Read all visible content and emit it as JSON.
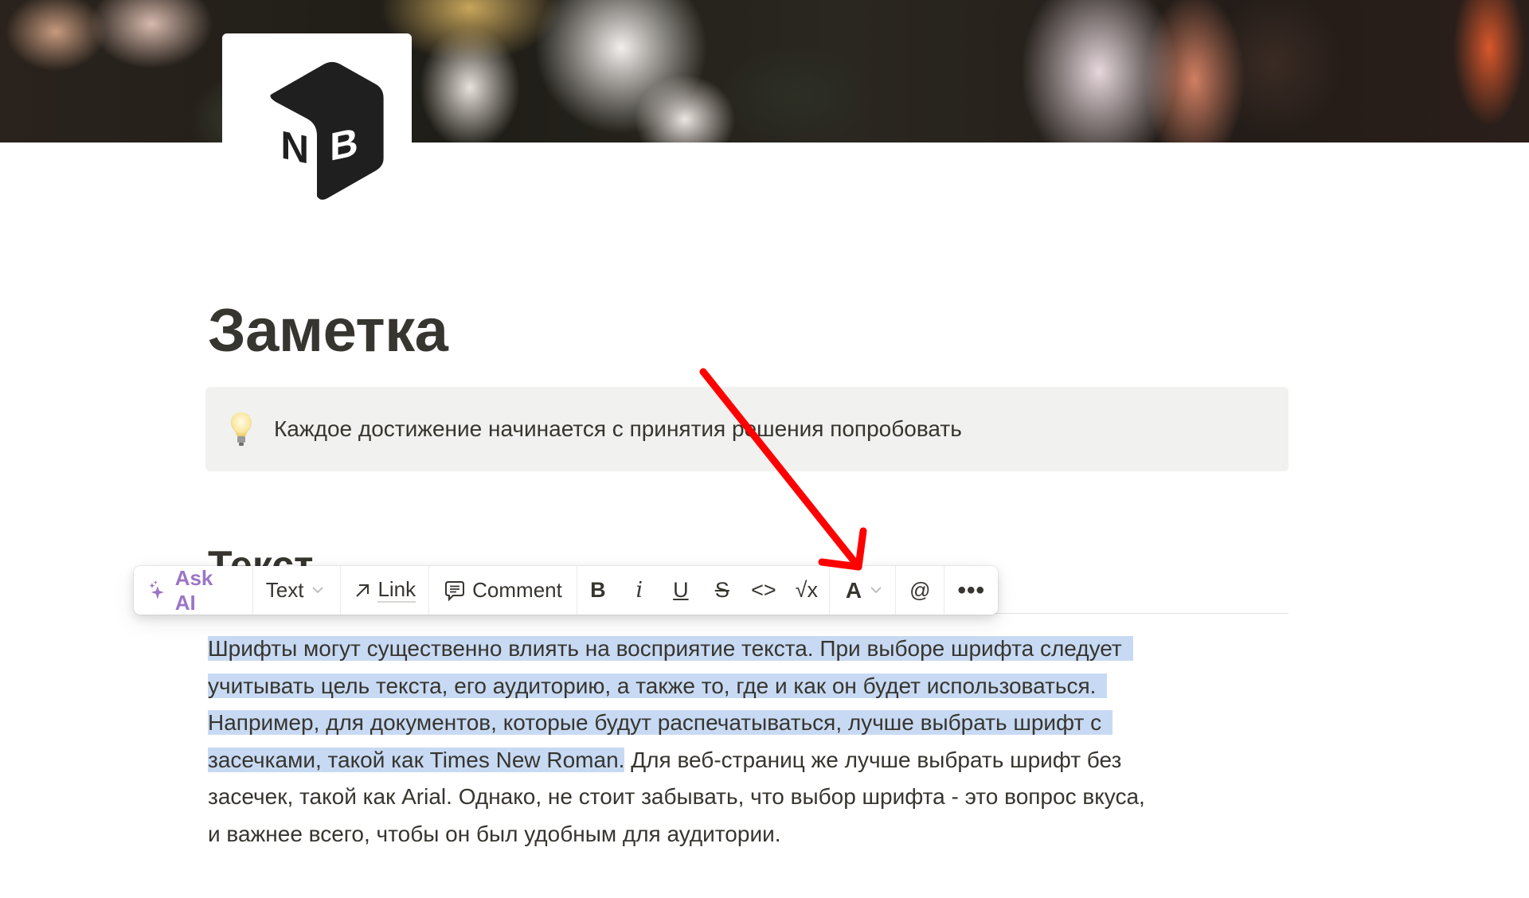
{
  "cover": {
    "icon": "floral-painting-cover"
  },
  "page_icon": {
    "icon": "notion-box-logo",
    "letters": [
      "N",
      "B"
    ]
  },
  "title": "Заметка",
  "callout": {
    "icon": "light-bulb-icon",
    "text": "Каждое достижение начинается с принятия решения попробовать",
    "background": "#f1f1ef"
  },
  "heading": "Текст",
  "paragraph": {
    "lines": [
      {
        "selected": "Шрифты могут существенно влиять на восприятие текста. При выборе шрифта следует",
        "rest": ""
      },
      {
        "selected": "учитывать цель текста, его аудиторию, а также то, где и как он будет использоваться.",
        "rest": ""
      },
      {
        "selected": "Например, для документов, которые будут распечатываться, лучше выбрать шрифт с",
        "rest": ""
      },
      {
        "selected": "засечками, такой как Times New Roman.",
        "rest": " Для веб-страниц же лучше выбрать шрифт без"
      },
      {
        "selected": "",
        "rest": "засечек, такой как Arial. Однако, не стоит забывать, что выбор шрифта - это вопрос вкуса,"
      },
      {
        "selected": "",
        "rest": "и важнее всего, чтобы он был удобным для аудитории."
      }
    ],
    "selection_color": "#c8daf3"
  },
  "toolbar": {
    "ask_ai": {
      "label": "Ask AI",
      "icon": "sparkles-icon",
      "color": "#9b75c7"
    },
    "block_type": {
      "label": "Text",
      "icon": "chevron-down-icon"
    },
    "link": {
      "label": "Link",
      "icon": "arrow-up-right-icon"
    },
    "comment": {
      "label": "Comment",
      "icon": "comment-icon"
    },
    "format": {
      "bold": "B",
      "italic": "i",
      "underline": "U",
      "strikethrough": "S",
      "code": "<>",
      "equation": "√x"
    },
    "text_color": {
      "label": "A",
      "icon": "chevron-down-icon"
    },
    "mention": "@",
    "more": "•••"
  },
  "annotation": {
    "type": "red-arrow",
    "color": "#ff0000",
    "points_to": "text-color-button"
  }
}
